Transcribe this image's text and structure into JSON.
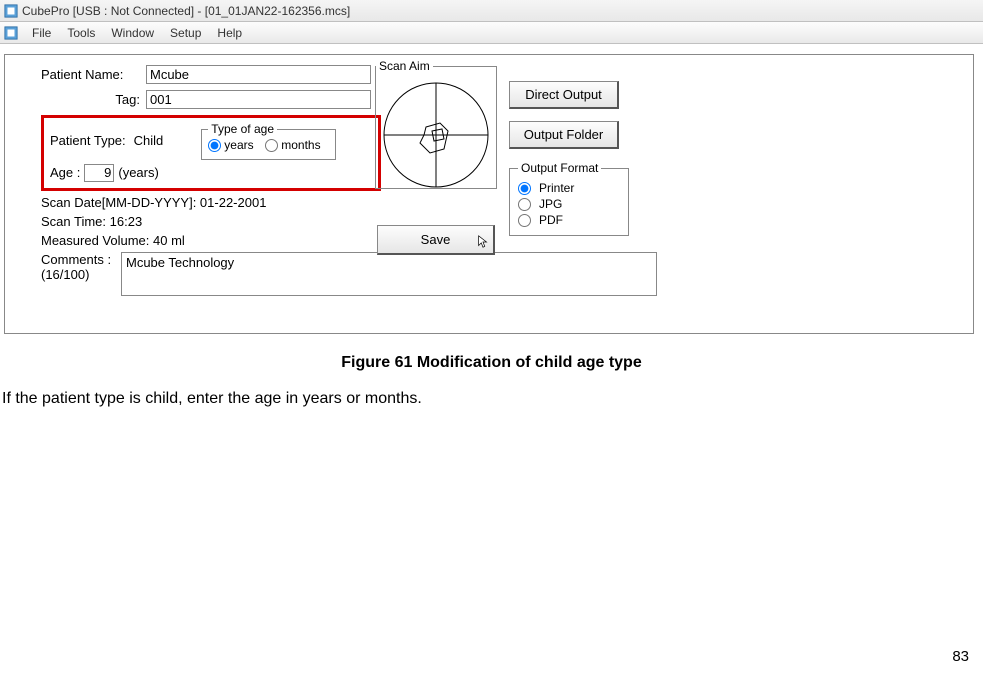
{
  "titlebar": {
    "text": "CubePro [USB : Not Connected] - [01_01JAN22-162356.mcs]"
  },
  "menubar": {
    "file": "File",
    "tools": "Tools",
    "window": "Window",
    "setup": "Setup",
    "help": "Help"
  },
  "form": {
    "patient_name_label": "Patient Name:",
    "patient_name_value": "Mcube",
    "tag_label": "Tag:",
    "tag_value": "001",
    "patient_type_label": "Patient Type:",
    "patient_type_value": "Child",
    "age_label": "Age :",
    "age_value": "9",
    "age_unit": "(years)",
    "type_of_age_legend": "Type of age",
    "radio_years": "years",
    "radio_months": "months",
    "scan_date": "Scan Date[MM-DD-YYYY]: 01-22-2001",
    "scan_time": "Scan Time: 16:23",
    "measured_volume": "Measured Volume: 40 ml",
    "comments_label": "Comments :",
    "comments_counter": "(16/100)",
    "comments_value": "Mcube Technology"
  },
  "scan_aim": {
    "legend": "Scan Aim"
  },
  "buttons": {
    "save": "Save",
    "direct_output": "Direct Output",
    "output_folder": "Output Folder"
  },
  "output_format": {
    "legend": "Output Format",
    "printer": "Printer",
    "jpg": "JPG",
    "pdf": "PDF"
  },
  "doc": {
    "figure_caption": "Figure 61 Modification of child age type",
    "body_text": "If the patient type is child, enter the age in years or months.",
    "page_number": "83"
  }
}
